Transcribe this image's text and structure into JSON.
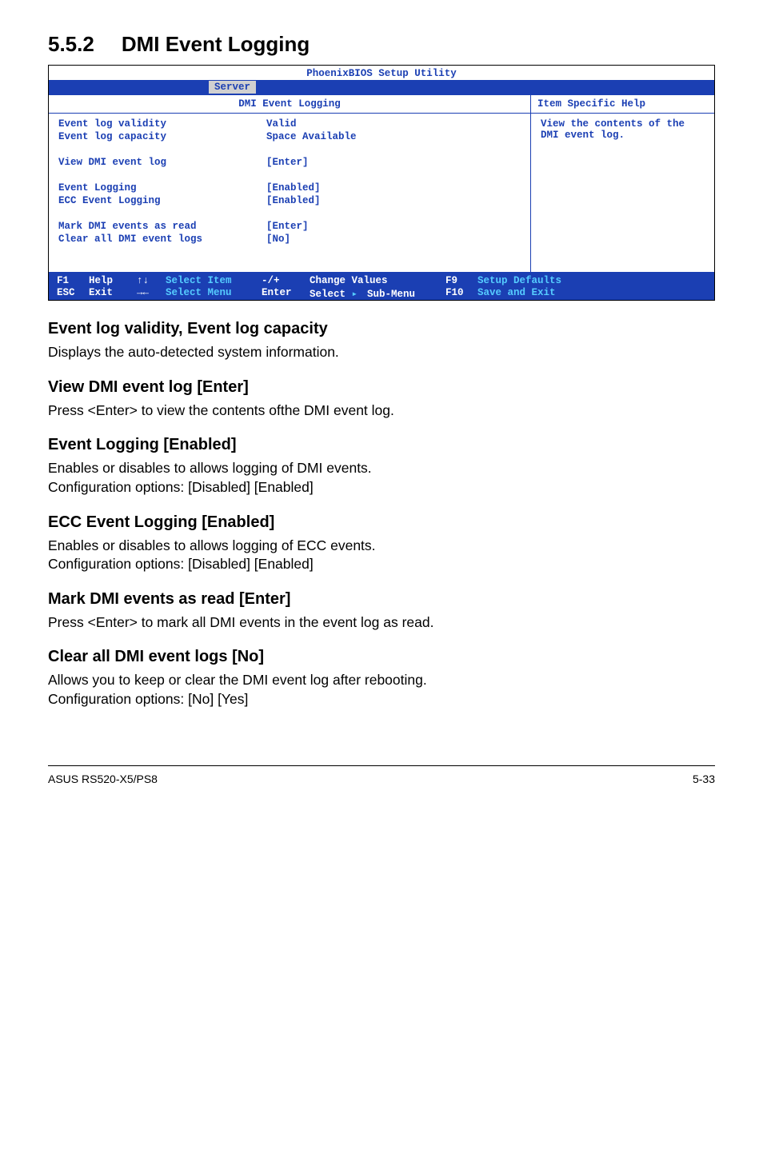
{
  "section": {
    "number": "5.5.2",
    "title": "DMI Event Logging"
  },
  "bios": {
    "title": "PhoenixBIOS Setup Utility",
    "tab": "Server",
    "left_header": "DMI Event Logging",
    "right_header": "Item Specific Help",
    "help_text": "View the contents of the DMI event log.",
    "rows": [
      {
        "label": "Event log validity",
        "value": "Valid"
      },
      {
        "label": "Event log capacity",
        "value": "Space Available"
      },
      {
        "spacer": true
      },
      {
        "label": "View DMI event log",
        "value": "[Enter]"
      },
      {
        "spacer": true
      },
      {
        "label": "Event Logging",
        "value": "[Enabled]"
      },
      {
        "label": "ECC Event Logging",
        "value": "[Enabled]"
      },
      {
        "spacer": true
      },
      {
        "label": "Mark DMI events as read",
        "value": "[Enter]"
      },
      {
        "label": "Clear all DMI event logs",
        "value": "[No]"
      }
    ],
    "footer": {
      "f1": "F1",
      "help": "Help",
      "arrows_ud": "↑↓",
      "select_item": "Select Item",
      "minusplus": "-/+",
      "change_values": "Change Values",
      "f9": "F9",
      "setup_defaults": "Setup Defaults",
      "esc": "ESC",
      "exit": "Exit",
      "arrows_lr": "→←",
      "select_menu": "Select Menu",
      "enter": "Enter",
      "select_submenu": "Select    Sub-Menu",
      "submenu_tri": "▸",
      "f10": "F10",
      "save_exit": "Save and Exit"
    }
  },
  "sections": [
    {
      "heading": "Event log validity, Event log capacity",
      "body": "Displays the auto-detected system information."
    },
    {
      "heading": "View DMI event log [Enter]",
      "body": "Press <Enter> to view the contents ofthe DMI event log."
    },
    {
      "heading": "Event Logging [Enabled]",
      "body": "Enables or disables to allows logging of DMI events.\nConfiguration options: [Disabled] [Enabled]"
    },
    {
      "heading": "ECC Event Logging [Enabled]",
      "body": "Enables or disables to allows logging of ECC events.\nConfiguration options: [Disabled] [Enabled]"
    },
    {
      "heading": "Mark DMI events as read [Enter]",
      "body": "Press <Enter> to mark all DMI events in the event log as read."
    },
    {
      "heading": "Clear all DMI event logs [No]",
      "body": "Allows you to keep or clear the DMI event log after rebooting.\nConfiguration options: [No] [Yes]"
    }
  ],
  "page_footer": {
    "left": "ASUS RS520-X5/PS8",
    "right": "5-33"
  }
}
